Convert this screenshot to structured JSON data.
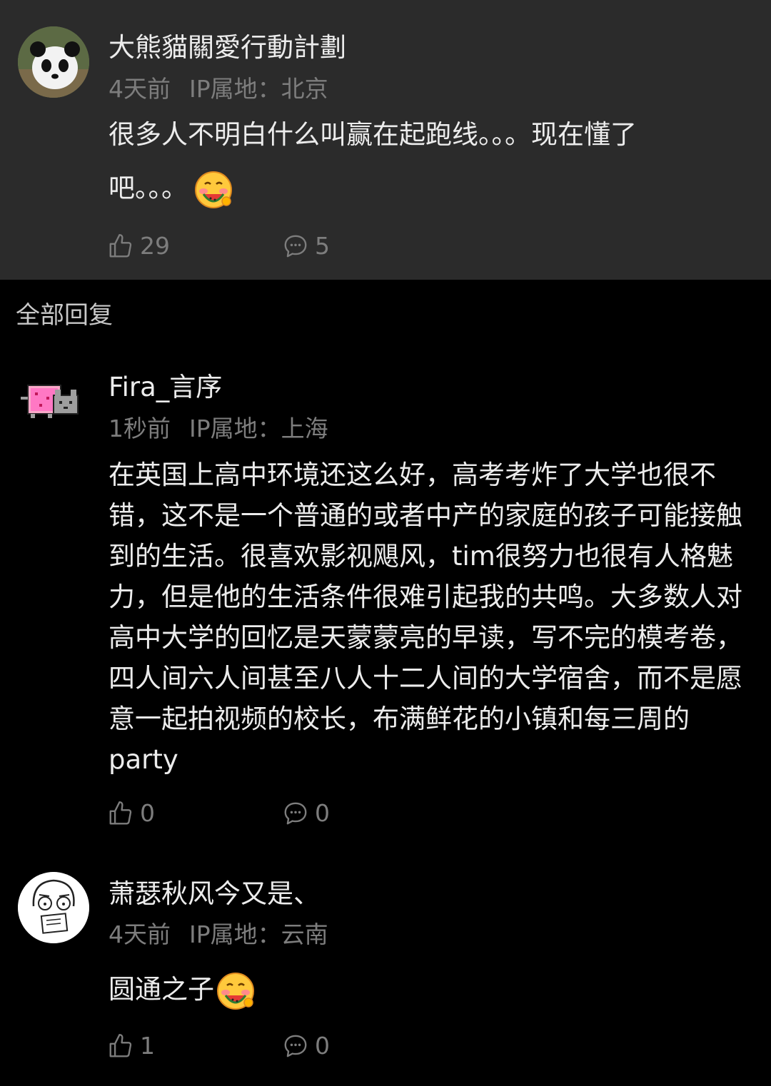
{
  "parent_comment": {
    "username": "大熊貓關愛行動計劃",
    "time": "4天前",
    "ip": "IP属地：北京",
    "text_line1": "很多人不明白什么叫赢在起跑线。。。现在懂了",
    "text_line2": "吧。。。",
    "likes": "29",
    "replies": "5",
    "avatar_icon": "panda-avatar",
    "emoji_icon": "eating-watermelon-emoji"
  },
  "section_title": "全部回复",
  "replies": [
    {
      "username": "Fira_言序",
      "time": "1秒前",
      "ip": "IP属地：上海",
      "text": "在英国上高中环境还这么好，高考考炸了大学也很不错，这不是一个普通的或者中产的家庭的孩子可能接触到的生活。很喜欢影视飓风，tim很努力也很有人格魅力，但是他的生活条件很难引起我的共鸣。大多数人对高中大学的回忆是天蒙蒙亮的早读，写不完的模考卷，四人间六人间甚至八人十二人间的大学宿舍，而不是愿意一起拍视频的校长，布满鲜花的小镇和每三周的party",
      "likes": "0",
      "replies": "0",
      "avatar_icon": "nyan-cat-avatar"
    },
    {
      "username": "萧瑟秋风今又是、",
      "time": "4天前",
      "ip": "IP属地：云南",
      "text": "圆通之子",
      "likes": "1",
      "replies": "0",
      "avatar_icon": "cartoon-face-avatar",
      "emoji_icon": "eating-watermelon-emoji"
    }
  ],
  "colors": {
    "parent_bg": "#2b2b2b",
    "page_bg": "#000000",
    "meta_text": "#7d7d7d"
  }
}
